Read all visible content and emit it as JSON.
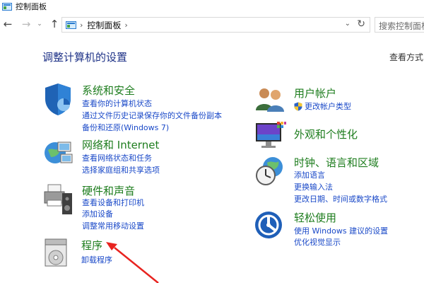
{
  "window": {
    "title": "控制面板"
  },
  "address_bar": {
    "crumb": "控制面板",
    "search_placeholder": "搜索控制面板"
  },
  "header": {
    "heading": "调整计算机的设置",
    "view_by": "查看方式"
  },
  "left_categories": [
    {
      "title": "系统和安全",
      "links": [
        "查看你的计算机状态",
        "通过文件历史记录保存你的文件备份副本",
        "备份和还原(Windows 7)"
      ]
    },
    {
      "title": "网络和 Internet",
      "links": [
        "查看网络状态和任务",
        "选择家庭组和共享选项"
      ]
    },
    {
      "title": "硬件和声音",
      "links": [
        "查看设备和打印机",
        "添加设备",
        "调整常用移动设置"
      ]
    },
    {
      "title": "程序",
      "links": [
        "卸载程序"
      ]
    }
  ],
  "right_categories": [
    {
      "title": "用户帐户",
      "links": [
        "更改帐户类型"
      ]
    },
    {
      "title": "外观和个性化",
      "links": []
    },
    {
      "title": "时钟、语言和区域",
      "links": [
        "添加语言",
        "更换输入法",
        "更改日期、时间或数字格式"
      ]
    },
    {
      "title": "轻松使用",
      "links": [
        "使用 Windows 建议的设置",
        "优化视觉显示"
      ]
    }
  ],
  "annotation": {
    "arrow_color": "#e8231f"
  },
  "colors": {
    "category_title": "#1e7d1e",
    "link": "#1a49c8",
    "heading": "#1e3287"
  }
}
